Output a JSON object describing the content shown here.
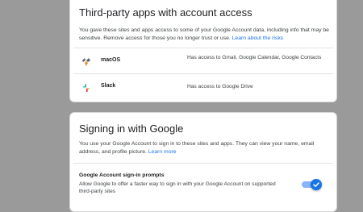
{
  "third_party": {
    "title": "Third-party apps with account access",
    "description": "You gave these sites and apps access to some of your Google Account data, including info that may be sensitive. Remove access for those you no longer trust or use.",
    "link": "Learn about the risks",
    "apps": [
      {
        "name": "macOS",
        "access": "Has access to Gmail, Google Calendar, Google Contacts",
        "icon": "macos-finder-icon"
      },
      {
        "name": "Slack",
        "access": "Has access to Google Drive",
        "icon": "slack-icon"
      }
    ]
  },
  "signin": {
    "title": "Signing in with Google",
    "description": "You use your Google Account to sign in to these sites and apps. They can view your name, email address, and profile picture.",
    "link": "Learn more",
    "prompt_title": "Google Account sign-in prompts",
    "prompt_desc": "Allow Google to offer a faster way to sign in with your Google Account on supported third-party sites",
    "toggle_on": true
  },
  "colors": {
    "accent": "#1a73e8",
    "overlay": "#9a9a9a"
  }
}
